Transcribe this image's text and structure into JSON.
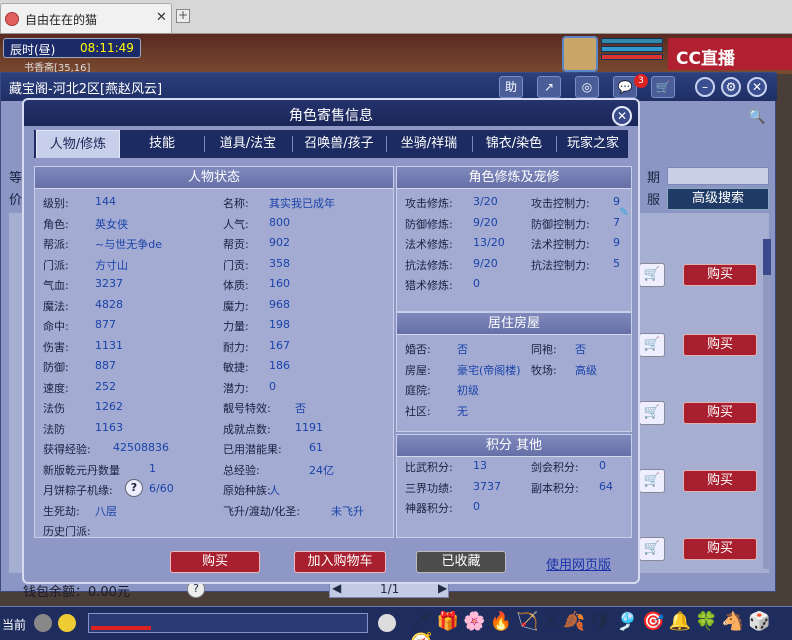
{
  "browser": {
    "tab_title": "自由在在的猫",
    "close": "✕",
    "new_tab": "+"
  },
  "game": {
    "time_label": "辰时(昼)",
    "clock": "08:11:49",
    "coord": "书香斋[35,16]",
    "logo": "CC直播"
  },
  "store": {
    "title": "藏宝阁-河北2区[燕赵风云]",
    "tools": [
      "助",
      "↗",
      "◎",
      "💬",
      "🛒"
    ],
    "notification_count": "3",
    "window_btns": [
      "–",
      "⚙",
      "✕"
    ],
    "row1_left": "等",
    "row1_right": "期",
    "row2_left": "价",
    "row2_right": "服",
    "advanced_search": "高级搜索",
    "search_icon": "🔍",
    "cart_icon": "🛒",
    "buy_label": "购买",
    "wallet": "钱包余额：0.00元",
    "help": "?",
    "pager": "1/1",
    "pager_prev": "◀",
    "pager_next": "▶"
  },
  "modal": {
    "title": "角色寄售信息",
    "close": "✕",
    "tabs": [
      "人物/修炼",
      "技能",
      "道具/法宝",
      "召唤兽/孩子",
      "坐骑/祥瑞",
      "锦衣/染色",
      "玩家之家"
    ],
    "status_header": "人物状态",
    "status_left": [
      {
        "k": "级别:",
        "v": "144"
      },
      {
        "k": "角色:",
        "v": "英女侠"
      },
      {
        "k": "帮派:",
        "v": "~与世无争de"
      },
      {
        "k": "门派:",
        "v": "方寸山"
      },
      {
        "k": "气血:",
        "v": "3237"
      },
      {
        "k": "魔法:",
        "v": "4828"
      },
      {
        "k": "命中:",
        "v": "877"
      },
      {
        "k": "伤害:",
        "v": "1131"
      },
      {
        "k": "防御:",
        "v": "887"
      },
      {
        "k": "速度:",
        "v": "252"
      },
      {
        "k": "法伤",
        "v": "1262"
      },
      {
        "k": "法防",
        "v": "1163"
      },
      {
        "k": "获得经验:",
        "v": "42508836"
      },
      {
        "k": "新版乾元丹数量",
        "v": "1"
      },
      {
        "k": "月饼粽子机缘:",
        "v": "6/60"
      },
      {
        "k": "生死劫:",
        "v": "八层"
      },
      {
        "k": "历史门派:",
        "v": ""
      }
    ],
    "status_right": [
      {
        "k": "名称:",
        "v": "其实我已成年"
      },
      {
        "k": "人气:",
        "v": "800"
      },
      {
        "k": "帮贡:",
        "v": "902"
      },
      {
        "k": "门贡:",
        "v": "358"
      },
      {
        "k": "体质:",
        "v": "160"
      },
      {
        "k": "魔力:",
        "v": "968"
      },
      {
        "k": "力量:",
        "v": "198"
      },
      {
        "k": "耐力:",
        "v": "167"
      },
      {
        "k": "敏捷:",
        "v": "186"
      },
      {
        "k": "潜力:",
        "v": "0"
      },
      {
        "k": "靓号特效:",
        "v": "否"
      },
      {
        "k": "成就点数:",
        "v": "1191"
      },
      {
        "k": "已用潜能果:",
        "v": "61"
      },
      {
        "k": "总经验:",
        "v": "24亿"
      },
      {
        "k": "原始种族:",
        "v": "人"
      },
      {
        "k": "飞升/渡劫/化圣:",
        "v": "未飞升"
      }
    ],
    "cultivation_header": "角色修炼及宠修",
    "cultivation_left": [
      {
        "k": "攻击修炼:",
        "v": "3/20"
      },
      {
        "k": "防御修炼:",
        "v": "9/20"
      },
      {
        "k": "法术修炼:",
        "v": "13/20"
      },
      {
        "k": "抗法修炼:",
        "v": "9/20"
      },
      {
        "k": "猎术修炼:",
        "v": "0"
      }
    ],
    "cultivation_right": [
      {
        "k": "攻击控制力:",
        "v": "9"
      },
      {
        "k": "防御控制力:",
        "v": "7"
      },
      {
        "k": "法术控制力:",
        "v": "9"
      },
      {
        "k": "抗法控制力:",
        "v": "5"
      }
    ],
    "house_header": "居住房屋",
    "house_left": [
      {
        "k": "婚否:",
        "v": "否"
      },
      {
        "k": "房屋:",
        "v": "豪宅(帝阁楼)"
      },
      {
        "k": "庭院:",
        "v": "初级"
      },
      {
        "k": "社区:",
        "v": "无"
      }
    ],
    "house_right": [
      {
        "k": "同袍:",
        "v": "否"
      },
      {
        "k": "牧场:",
        "v": "高级"
      }
    ],
    "score_header": "积分 其他",
    "score_left": [
      {
        "k": "比武积分:",
        "v": "13"
      },
      {
        "k": "三界功绩:",
        "v": "3737"
      },
      {
        "k": "神器积分:",
        "v": "0"
      }
    ],
    "score_right": [
      {
        "k": "剑会积分:",
        "v": "0"
      },
      {
        "k": "副本积分:",
        "v": "64"
      }
    ],
    "buttons": {
      "buy": "购买",
      "add_cart": "加入购物车",
      "favorited": "已收藏",
      "web_version": "使用网页版"
    },
    "help": "?"
  },
  "bottom": {
    "channel": "当前"
  }
}
